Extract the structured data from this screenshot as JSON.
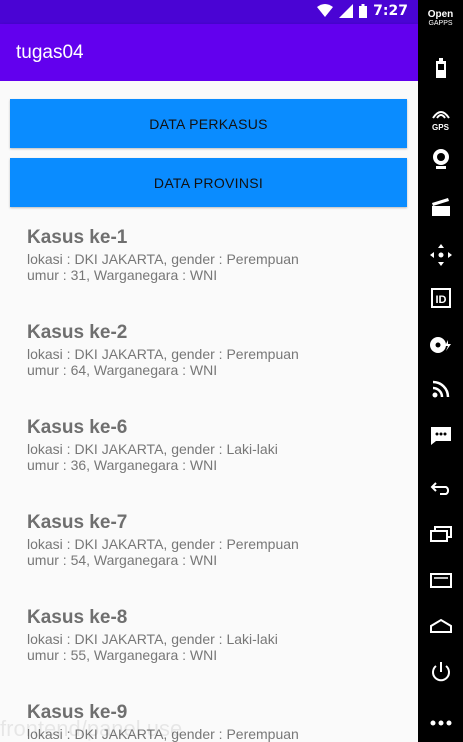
{
  "status_bar": {
    "time": "7:27"
  },
  "app_bar": {
    "title": "tugas04"
  },
  "buttons": {
    "perkasus": "DATA PERKASUS",
    "provinsi": "DATA PROVINSI"
  },
  "cases": [
    {
      "title": "Kasus ke-1",
      "line1": "lokasi : DKI JAKARTA, gender : Perempuan",
      "line2": "umur : 31, Warganegara : WNI"
    },
    {
      "title": "Kasus ke-2",
      "line1": "lokasi : DKI JAKARTA, gender : Perempuan",
      "line2": "umur : 64, Warganegara : WNI"
    },
    {
      "title": "Kasus ke-6",
      "line1": "lokasi : DKI JAKARTA, gender : Laki-laki",
      "line2": "umur : 36, Warganegara : WNI"
    },
    {
      "title": "Kasus ke-7",
      "line1": "lokasi : DKI JAKARTA, gender : Perempuan",
      "line2": "umur : 54, Warganegara : WNI"
    },
    {
      "title": "Kasus ke-8",
      "line1": "lokasi : DKI JAKARTA, gender : Laki-laki",
      "line2": "umur : 55, Warganegara : WNI"
    },
    {
      "title": "Kasus ke-9",
      "line1": "lokasi : DKI JAKARTA, gender : Perempuan",
      "line2": ""
    }
  ],
  "side_nav": {
    "brand_line1": "Open",
    "brand_line2": "GAPPS",
    "gps_label": "GPS",
    "icons": [
      "battery-icon",
      "gps-icon",
      "camera-icon",
      "clapperboard-icon",
      "dpad-icon",
      "id-icon",
      "media-icon",
      "rss-icon",
      "message-icon",
      "back-icon",
      "recents-icon",
      "home-icon",
      "menu-icon",
      "power-icon",
      "more-icon"
    ]
  },
  "watermark": "frontend/panel use"
}
